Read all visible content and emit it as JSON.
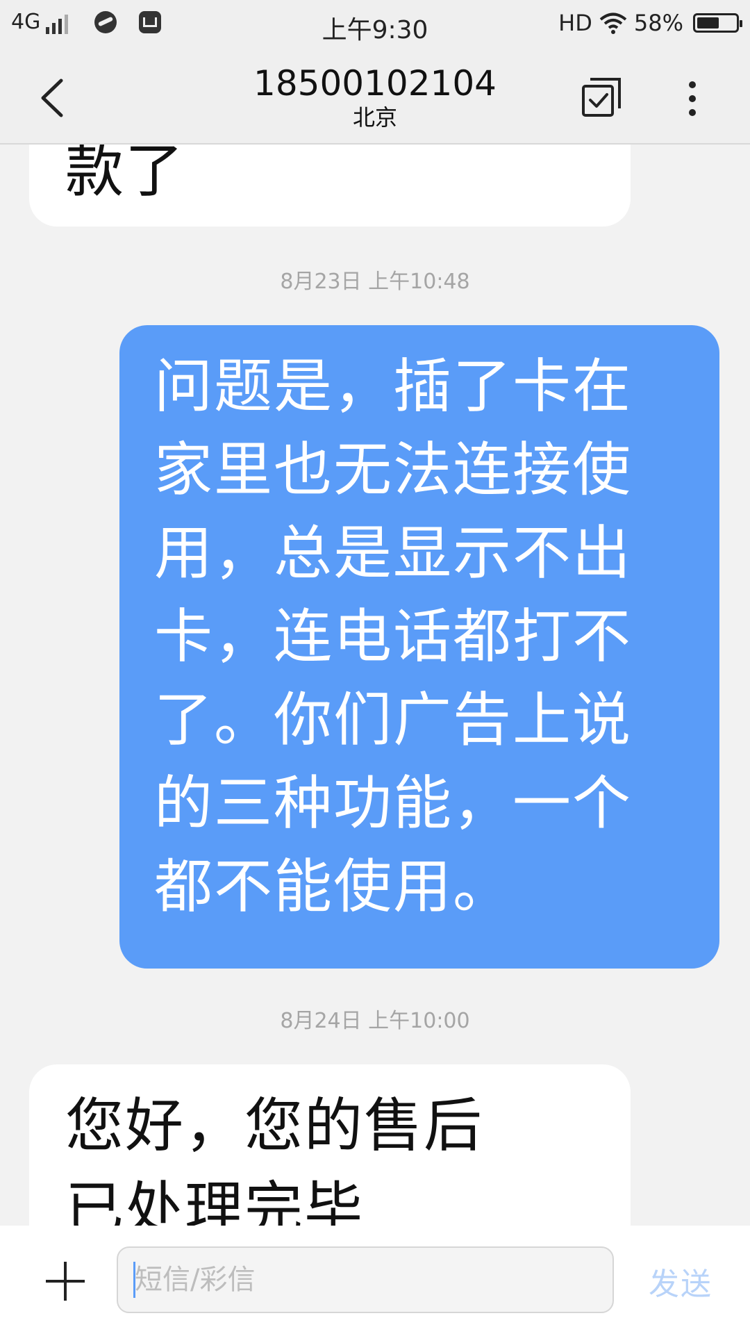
{
  "status_bar": {
    "network": "4G",
    "time": "上午9:30",
    "hd": "HD",
    "battery_text": "58%",
    "battery_level": 0.58
  },
  "header": {
    "title": "18500102104",
    "subtitle": "北京"
  },
  "conversation": {
    "messages": [
      {
        "direction": "incoming",
        "text": "款了"
      },
      {
        "timestamp": "8月23日 上午10:48"
      },
      {
        "direction": "outgoing",
        "text": "问题是，插了卡在\n家里也无法连接使\n用，总是显示不出\n卡，连电话都打不\n了。你们广告上说\n的三种功能，一个\n都不能使用。"
      },
      {
        "timestamp": "8月24日 上午10:00"
      },
      {
        "direction": "incoming",
        "text": "您好，您的售后\n已处理完毕"
      }
    ]
  },
  "input_bar": {
    "placeholder": "短信/彩信",
    "value": "",
    "send_label": "发送"
  },
  "colors": {
    "accent": "#5a9cf8",
    "send_disabled": "#b8d3f9",
    "background": "#f2f2f2"
  }
}
